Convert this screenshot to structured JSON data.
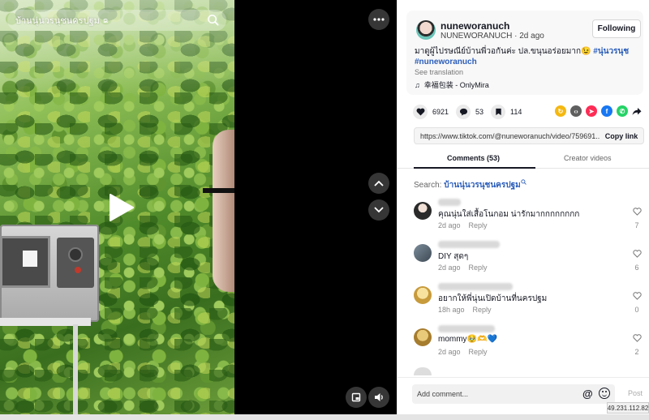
{
  "video": {
    "search_query": "บ้านนุ่นวรนุชนครปฐม",
    "search_suffix": "ຂ",
    "icons": {
      "search": "search-icon",
      "play": "play-icon",
      "more": "more-icon",
      "prev": "chevron-up-icon",
      "next": "chevron-down-icon",
      "pip": "picture-in-picture-icon",
      "volume": "volume-icon"
    }
  },
  "author": {
    "username": "nuneworanuch",
    "nickname": "NUNEWORANUCH",
    "separator": " · ",
    "posted": "2d ago",
    "follow_label": "Following"
  },
  "caption": {
    "text": "มาดูผู้ไปรษณีย์บ้านพี่วอกันค่ะ ปล.ขนุนอร่อยมาก😉 ",
    "hashtags": [
      "#นุ่นวรนุช",
      "#nuneworanuch"
    ],
    "see_translation": "See translation",
    "music": "幸福包装 - OnlyMira"
  },
  "stats": {
    "likes": "6921",
    "comments": "53",
    "saves": "114"
  },
  "share_colors": [
    "#f5b811",
    "#5f5f5f",
    "#fe2c55",
    "#1877f2",
    "#25d366"
  ],
  "link": {
    "url": "https://www.tiktok.com/@nuneworanuch/video/759691...",
    "copy_label": "Copy link"
  },
  "tabs": {
    "comments": "Comments (53)",
    "creator": "Creator videos"
  },
  "search_line": {
    "prefix": "Search: ",
    "query": "บ้านนุ่นวรนุชนครปฐม"
  },
  "comments": [
    {
      "text": "คุณนุ่นใส่เสื้อโนกอม น่ารักมากกกกกกกก",
      "time": "2d ago",
      "reply": "Reply",
      "likes": "7",
      "avatar_color": "#3a3a3a"
    },
    {
      "text": "DIY สุดๆ",
      "time": "2d ago",
      "reply": "Reply",
      "likes": "6",
      "avatar_color": "#5b6b7a"
    },
    {
      "text": "อยากให้พี่นุ่นเปิดบ้านที่นครปฐม",
      "time": "18h ago",
      "reply": "Reply",
      "likes": "0",
      "avatar_color": "#e2c36b"
    },
    {
      "text": "mommy🥹🫶💙",
      "time": "2d ago",
      "reply": "Reply",
      "likes": "2",
      "avatar_color": "#c9a24a"
    }
  ],
  "composer": {
    "placeholder": "Add comment...",
    "at": "@",
    "post_label": "Post"
  },
  "ip_label": "49.231.112.82"
}
